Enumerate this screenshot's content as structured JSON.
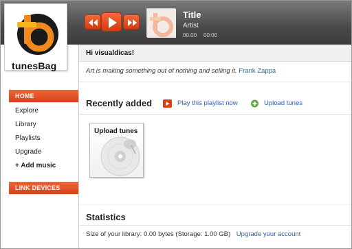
{
  "brand": {
    "name": "tunesBag",
    "accent": "#e8501f"
  },
  "player": {
    "title": "Title",
    "artist": "Artist",
    "current_time": "00:00",
    "duration": "00:00",
    "controls": [
      "rewind-icon",
      "play-icon",
      "fast-forward-icon"
    ]
  },
  "sidebar": {
    "home": "HOME",
    "items": [
      {
        "label": "Explore"
      },
      {
        "label": "Library"
      },
      {
        "label": "Playlists"
      },
      {
        "label": "Upgrade"
      }
    ],
    "add_music": "+ Add music",
    "link_devices": "LINK DEVICES"
  },
  "main": {
    "greeting": "Hi visualdicas!",
    "quote_text": "Art is making something out of nothing and selling it.",
    "quote_author": "Frank Zappa",
    "recently_added": {
      "title": "Recently added",
      "play_playlist": "Play this playlist now",
      "upload_tunes": "Upload tunes",
      "card_title": "Upload tunes"
    },
    "statistics": {
      "title": "Statistics",
      "library_size": "Size of your library: 0.00 bytes (Storage: 1.00 GB)",
      "upgrade_link": "Upgrade your account"
    }
  }
}
